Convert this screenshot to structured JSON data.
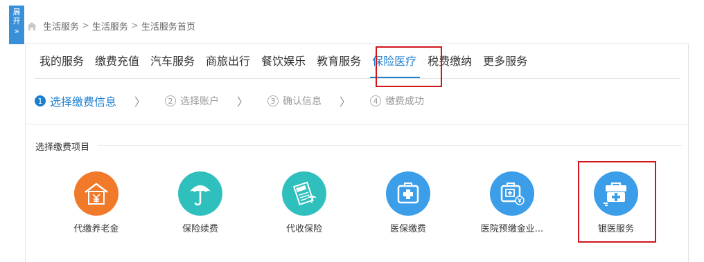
{
  "sidebar_toggle": {
    "label_1": "展",
    "label_2": "开",
    "arrow": "»"
  },
  "breadcrumb": {
    "home_icon": "home-icon",
    "items": [
      "生活服务",
      "生活服务",
      "生活服务首页"
    ],
    "separator": ">"
  },
  "tabs": [
    {
      "label": "我的服务"
    },
    {
      "label": "缴费充值"
    },
    {
      "label": "汽车服务"
    },
    {
      "label": "商旅出行"
    },
    {
      "label": "餐饮娱乐"
    },
    {
      "label": "教育服务"
    },
    {
      "label": "保险医疗",
      "active": true
    },
    {
      "label": "税费缴纳"
    },
    {
      "label": "更多服务"
    }
  ],
  "steps": [
    {
      "num": "1",
      "label": "选择缴费信息",
      "active": true
    },
    {
      "num": "2",
      "label": "选择账户"
    },
    {
      "num": "3",
      "label": "确认信息"
    },
    {
      "num": "4",
      "label": "缴费成功"
    }
  ],
  "section_title": "选择缴费项目",
  "services": [
    {
      "label": "代缴养老金",
      "icon": "house-yuan-icon",
      "color": "#f07a2a"
    },
    {
      "label": "保险续费",
      "icon": "umbrella-icon",
      "color": "#2fbfbd"
    },
    {
      "label": "代收保险",
      "icon": "policy-document-icon",
      "color": "#2fbfbd"
    },
    {
      "label": "医保缴费",
      "icon": "medical-cross-icon",
      "color": "#3c9ee8"
    },
    {
      "label": "医院预缴金业...",
      "icon": "hospital-prepay-icon",
      "color": "#3c9ee8"
    },
    {
      "label": "银医服务",
      "icon": "medical-kit-icon",
      "color": "#3c9ee8"
    }
  ],
  "colors": {
    "accent": "#1b7fd0",
    "highlight_border": "#d0151c"
  }
}
